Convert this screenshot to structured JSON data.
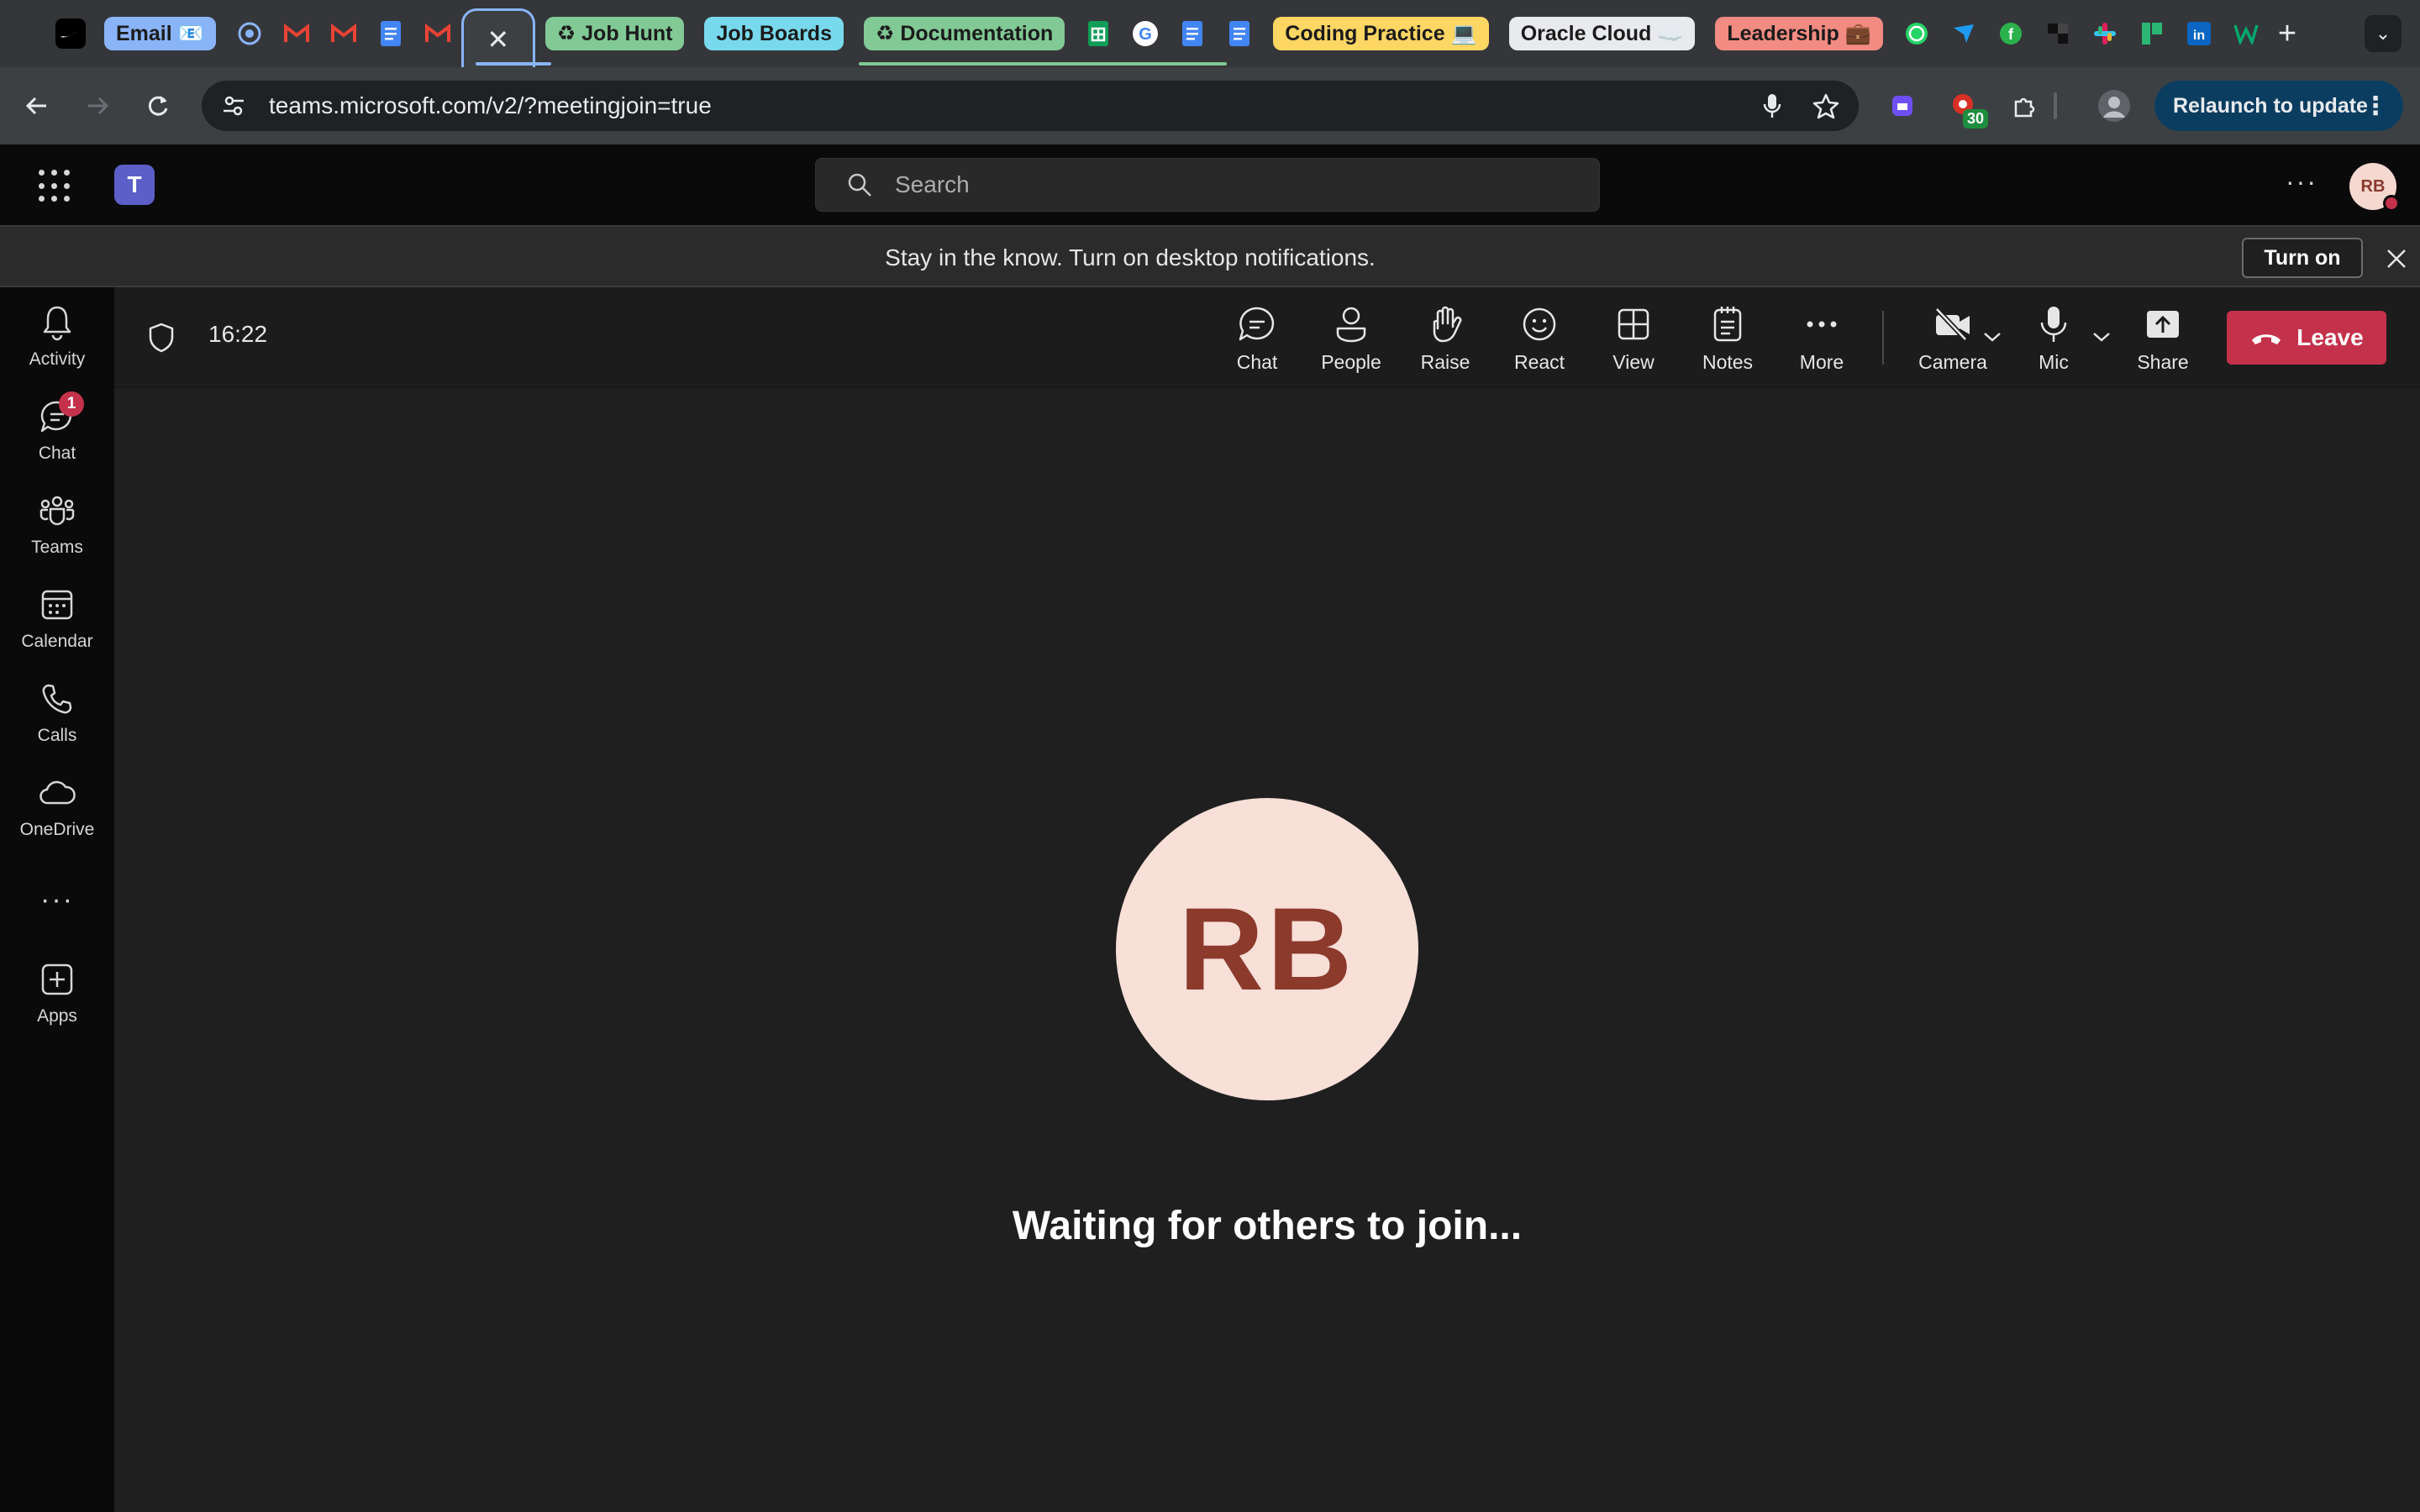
{
  "browser": {
    "tabs": [
      {
        "kind": "favicon",
        "icon": "nike-icon",
        "glyph": "✔",
        "color": "#000000"
      },
      {
        "kind": "group",
        "label": "Email 📧",
        "color": "#8ab4f8"
      },
      {
        "kind": "favicon",
        "icon": "chrome-icon",
        "glyph": "◎",
        "color": "#4a6fa5"
      },
      {
        "kind": "favicon",
        "icon": "gmail-icon",
        "glyph": "M",
        "color": "#ea4335"
      },
      {
        "kind": "favicon",
        "icon": "gmail-icon",
        "glyph": "M",
        "color": "#ea4335"
      },
      {
        "kind": "favicon",
        "icon": "docs-icon",
        "glyph": "≡",
        "color": "#4285f4"
      },
      {
        "kind": "favicon",
        "icon": "gmail-icon",
        "glyph": "M",
        "color": "#ea4335"
      },
      {
        "kind": "active",
        "icon": "close-icon",
        "glyph": "✕"
      },
      {
        "kind": "group",
        "label": "♻ Job Hunt",
        "color": "#81c995"
      },
      {
        "kind": "group",
        "label": "Job Boards",
        "color": "#78d9ec"
      },
      {
        "kind": "group",
        "label": "♻ Documentation",
        "color": "#81c995"
      },
      {
        "kind": "favicon",
        "icon": "sheets-icon",
        "glyph": "╋",
        "color": "#0f9d58"
      },
      {
        "kind": "favicon",
        "icon": "google-icon",
        "glyph": "G",
        "color": "#ffffff"
      },
      {
        "kind": "favicon",
        "icon": "docs-icon",
        "glyph": "≡",
        "color": "#4285f4"
      },
      {
        "kind": "favicon",
        "icon": "docs-icon",
        "glyph": "≡",
        "color": "#4285f4"
      },
      {
        "kind": "group",
        "label": "Coding Practice 💻",
        "color": "#fdd663"
      },
      {
        "kind": "group",
        "label": "Oracle Cloud ☁️",
        "color": "#e8eaed"
      },
      {
        "kind": "group",
        "label": "Leadership 💼",
        "color": "#f28b82"
      },
      {
        "kind": "favicon",
        "icon": "whatsapp-icon",
        "glyph": "✆",
        "color": "#25d366"
      },
      {
        "kind": "favicon",
        "icon": "bird-icon",
        "glyph": "➶",
        "color": "#1d9bf0"
      },
      {
        "kind": "favicon",
        "icon": "feedly-icon",
        "glyph": "f",
        "color": "#2bb24c"
      },
      {
        "kind": "favicon",
        "icon": "squares-icon",
        "glyph": "▚",
        "color": "#111111"
      },
      {
        "kind": "favicon",
        "icon": "slack-icon",
        "glyph": "✱",
        "color": "#e01e5a"
      },
      {
        "kind": "favicon",
        "icon": "bookmark-icon",
        "glyph": "▙",
        "color": "#2bb673"
      },
      {
        "kind": "favicon",
        "icon": "linkedin-icon",
        "glyph": "in",
        "color": "#0a66c2"
      },
      {
        "kind": "favicon",
        "icon": "w3-icon",
        "glyph": "W",
        "color": "#04aa6d"
      }
    ],
    "url": "teams.microsoft.com/v2/?meetingjoin=true",
    "extension_badge": "30",
    "relaunch_label": "Relaunch to update"
  },
  "teams": {
    "search_placeholder": "Search",
    "avatar_initials": "RB",
    "notification": {
      "message": "Stay in the know. Turn on desktop notifications.",
      "button": "Turn on"
    },
    "rail": [
      {
        "label": "Activity",
        "icon": "bell-icon"
      },
      {
        "label": "Chat",
        "icon": "chat-icon",
        "badge": "1"
      },
      {
        "label": "Teams",
        "icon": "teams-icon"
      },
      {
        "label": "Calendar",
        "icon": "calendar-icon"
      },
      {
        "label": "Calls",
        "icon": "phone-icon"
      },
      {
        "label": "OneDrive",
        "icon": "cloud-icon"
      },
      {
        "label": "Apps",
        "icon": "add-app-icon"
      }
    ],
    "meeting": {
      "timer": "16:22",
      "tools": [
        {
          "label": "Chat",
          "icon": "chat-icon"
        },
        {
          "label": "People",
          "icon": "people-icon"
        },
        {
          "label": "Raise",
          "icon": "raise-hand-icon"
        },
        {
          "label": "React",
          "icon": "smiley-icon"
        },
        {
          "label": "View",
          "icon": "grid-view-icon"
        },
        {
          "label": "Notes",
          "icon": "notes-icon"
        },
        {
          "label": "More",
          "icon": "more-icon"
        },
        {
          "label": "Camera",
          "icon": "camera-off-icon"
        },
        {
          "label": "Mic",
          "icon": "mic-icon"
        },
        {
          "label": "Share",
          "icon": "share-icon"
        }
      ],
      "leave_label": "Leave",
      "participant_initials": "RB",
      "waiting_text": "Waiting for others to join..."
    }
  },
  "colors": {
    "leave": "#c4314b",
    "avatar_bg": "#f8dfd8",
    "avatar_text": "#8b3a2c",
    "accent_teams": "#5b5fc7"
  }
}
